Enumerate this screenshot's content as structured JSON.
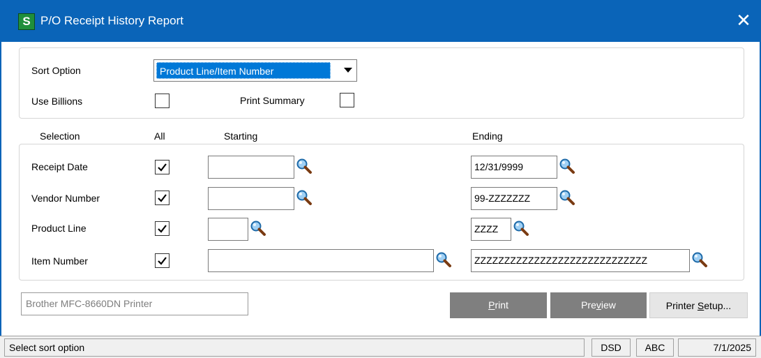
{
  "window": {
    "title": "P/O Receipt History Report",
    "app_icon_letter": "S",
    "close_glyph": "✕"
  },
  "options": {
    "sort_option_label": "Sort Option",
    "sort_option_value": "Product Line/Item Number",
    "use_billions_label": "Use Billions",
    "use_billions_checked": false,
    "print_summary_label": "Print Summary",
    "print_summary_checked": false
  },
  "selection": {
    "headers": {
      "selection": "Selection",
      "all": "All",
      "starting": "Starting",
      "ending": "Ending"
    },
    "rows": [
      {
        "label": "Receipt Date",
        "all": true,
        "starting": "",
        "ending": "12/31/9999"
      },
      {
        "label": "Vendor Number",
        "all": true,
        "starting": "",
        "ending": "99-ZZZZZZZ"
      },
      {
        "label": "Product Line",
        "all": true,
        "starting": "",
        "ending": "ZZZZ"
      },
      {
        "label": "Item Number",
        "all": true,
        "starting": "",
        "ending": "ZZZZZZZZZZZZZZZZZZZZZZZZZZZZZ"
      }
    ]
  },
  "printer": {
    "name": "Brother MFC-8660DN Printer"
  },
  "buttons": {
    "print": {
      "pre": "",
      "accel": "P",
      "post": "rint"
    },
    "preview": {
      "pre": "Pre",
      "accel": "v",
      "post": "iew"
    },
    "printer_setup": {
      "pre": "Printer ",
      "accel": "S",
      "post": "etup..."
    }
  },
  "status": {
    "message": "Select sort option",
    "module": "DSD",
    "company": "ABC",
    "date": "7/1/2025"
  },
  "colors": {
    "titlebar": "#0a64b8",
    "selection_highlight": "#0078d7",
    "dark_button": "#7f7f7f"
  }
}
